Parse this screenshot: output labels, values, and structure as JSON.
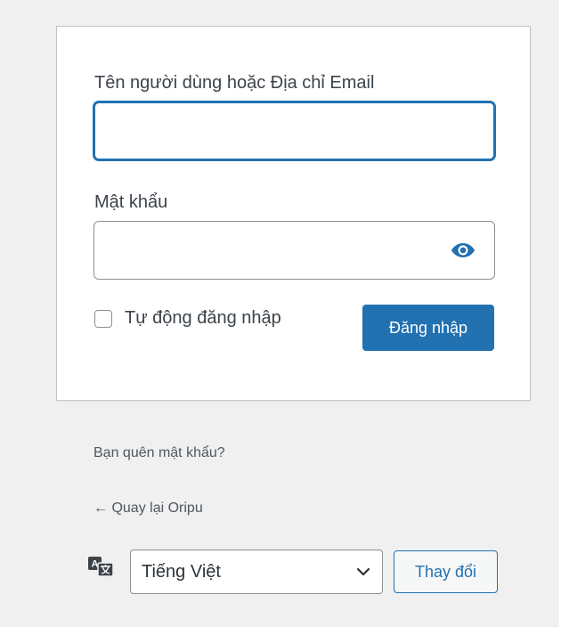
{
  "login_form": {
    "username_label": "Tên người dùng hoặc Địa chỉ Email",
    "username_value": "",
    "password_label": "Mật khẩu",
    "password_value": "",
    "show_password_icon": "eye-icon",
    "remember_label": "Tự động đăng nhập",
    "remember_checked": false,
    "login_button": "Đăng nhập"
  },
  "links": {
    "lost_password": "Bạn quên mật khẩu?",
    "back_to_site": "← Quay lại Oripu"
  },
  "language": {
    "icon": "translate-icon",
    "selected": "Tiếng Việt",
    "change_button": "Thay đổi"
  },
  "colors": {
    "accent": "#2271b1",
    "page_background": "#f0f0f1",
    "text": "#3c434a"
  }
}
